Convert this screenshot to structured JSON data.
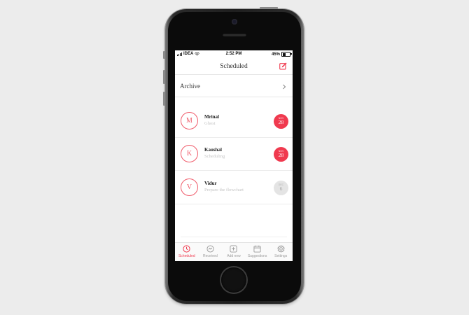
{
  "status_bar": {
    "carrier": "IDEA",
    "time": "2:52 PM",
    "battery": "45%"
  },
  "header": {
    "title": "Scheduled",
    "compose_icon": "compose-icon"
  },
  "archive": {
    "label": "Archive",
    "chevron_icon": "chevron-right-icon"
  },
  "messages": [
    {
      "initial": "M",
      "name": "Mrinal",
      "subtitle": "Ghost",
      "month": "NOV",
      "day": "28",
      "highlight": true
    },
    {
      "initial": "K",
      "name": "Kaushal",
      "subtitle": "Scheduling",
      "month": "NOV",
      "day": "28",
      "highlight": true
    },
    {
      "initial": "V",
      "name": "Vidur",
      "subtitle": "Prepare the flowchart",
      "month": "DEC",
      "day": "6",
      "highlight": false
    }
  ],
  "tabs": [
    {
      "label": "Scheduled",
      "icon": "clock-icon",
      "active": true
    },
    {
      "label": "Received",
      "icon": "inbox-icon",
      "active": false
    },
    {
      "label": "Add new",
      "icon": "plus-icon",
      "active": false
    },
    {
      "label": "Suggestions",
      "icon": "calendar-icon",
      "active": false
    },
    {
      "label": "Settings",
      "icon": "gear-icon",
      "active": false
    }
  ],
  "colors": {
    "accent": "#f03a4f",
    "muted": "#e4e4e4",
    "background": "#ececec"
  }
}
